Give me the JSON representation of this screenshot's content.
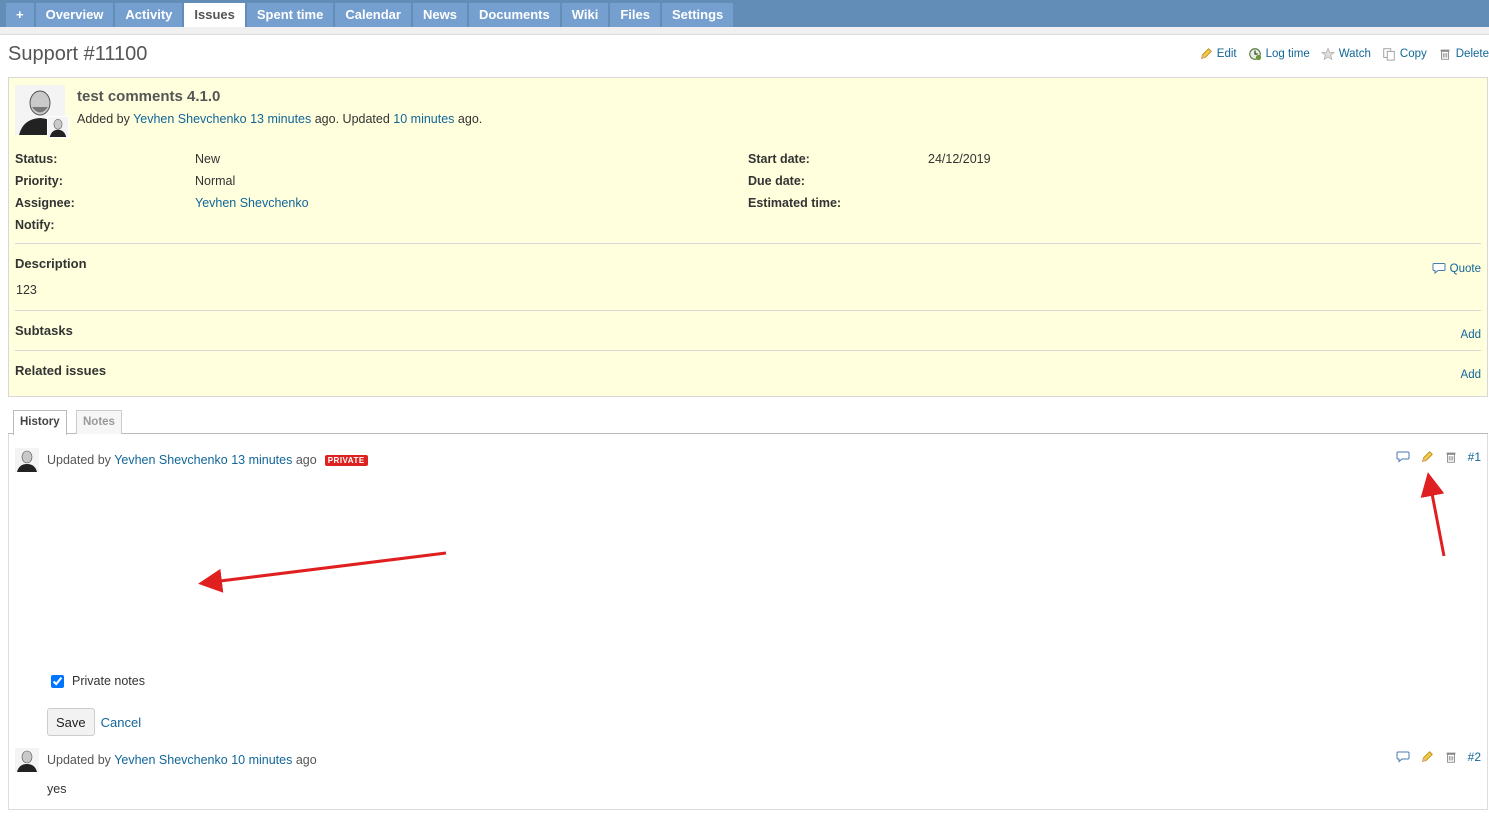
{
  "menu": {
    "items": [
      {
        "label": "+"
      },
      {
        "label": "Overview"
      },
      {
        "label": "Activity"
      },
      {
        "label": "Issues",
        "selected": true
      },
      {
        "label": "Spent time"
      },
      {
        "label": "Calendar"
      },
      {
        "label": "News"
      },
      {
        "label": "Documents"
      },
      {
        "label": "Wiki"
      },
      {
        "label": "Files"
      },
      {
        "label": "Settings"
      }
    ]
  },
  "issue": {
    "title": "Support #11100",
    "subject": "test comments 4.1.0",
    "added_by_prefix": "Added by",
    "author": "Yevhen Shevchenko",
    "created_ago": "13 minutes",
    "updated_text": "ago. Updated",
    "updated_ago": "10 minutes",
    "ago_suffix": "ago.",
    "attributes_left": [
      {
        "label": "Status:",
        "value": "New"
      },
      {
        "label": "Priority:",
        "value": "Normal"
      },
      {
        "label": "Assignee:",
        "value": "Yevhen Shevchenko"
      },
      {
        "label": "Notify:",
        "value": ""
      }
    ],
    "attributes_right": [
      {
        "label": "Start date:",
        "value": "24/12/2019"
      },
      {
        "label": "Due date:",
        "value": ""
      },
      {
        "label": "Estimated time:",
        "value": ""
      }
    ],
    "description_title": "Description",
    "description": "123",
    "quote_label": "Quote",
    "subtasks_title": "Subtasks",
    "related_title": "Related issues",
    "add_label": "Add"
  },
  "contextual": {
    "edit": "Edit",
    "log_time": "Log time",
    "watch": "Watch",
    "copy": "Copy",
    "delete": "Delete"
  },
  "tabs": {
    "history": "History",
    "notes": "Notes"
  },
  "journals": [
    {
      "prefix": "Updated by",
      "author": "Yevhen Shevchenko",
      "ago": "13 minutes",
      "suffix": "ago",
      "badge": "PRIVATE",
      "number": "#1"
    },
    {
      "prefix": "Updated by",
      "author": "Yevhen Shevchenko",
      "ago": "10 minutes",
      "suffix": "ago",
      "number": "#2",
      "note": "yes"
    }
  ],
  "edit_form": {
    "private_notes_label": "Private notes",
    "private_checked": true,
    "save_label": "Save",
    "cancel_label": "Cancel"
  },
  "colors": {
    "menu_bg": "#628db6",
    "tab_bg": "#759fcf",
    "issue_bg": "#ffffdd",
    "link": "#169",
    "annotation_arrow": "#e02020"
  },
  "icons": [
    "pencil-icon",
    "clock-icon",
    "star-icon",
    "copy-icon",
    "trash-icon",
    "speech-bubble-icon",
    "checkbox-icon"
  ]
}
